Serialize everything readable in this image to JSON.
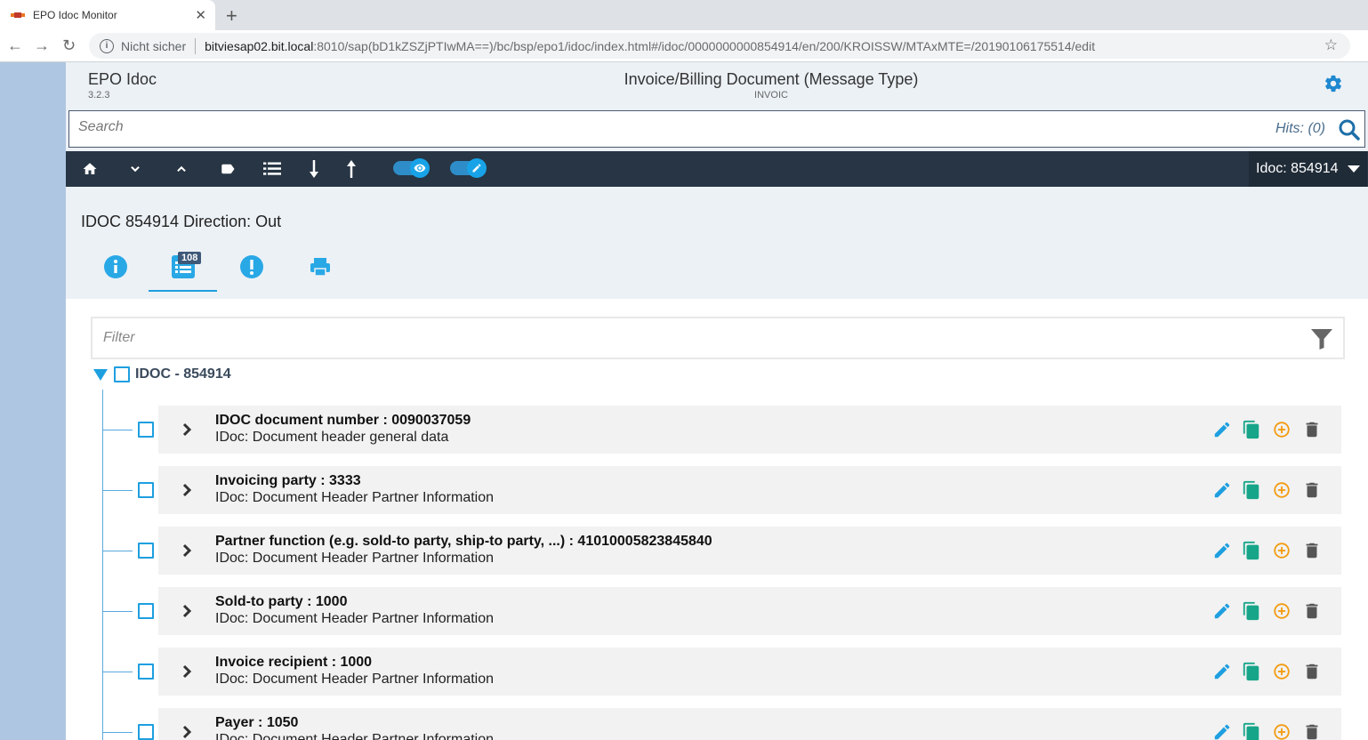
{
  "browser": {
    "tab_title": "EPO Idoc Monitor",
    "insecure_label": "Nicht sicher",
    "url_host": "bitviesap02.bit.local",
    "url_path": ":8010/sap(bD1kZSZjPTIwMA==)/bc/bsp/epo1/idoc/index.html#/idoc/0000000000854914/en/200/KROISSW/MTAxMTE=/20190106175514/edit"
  },
  "app": {
    "brand": "EPO Idoc",
    "version": "3.2.3",
    "doc_title": "Invoice/Billing Document (Message Type)",
    "doc_subtitle": "INVOIC"
  },
  "search": {
    "placeholder": "Search",
    "hits": "Hits: (0)"
  },
  "toolbar": {
    "idoc_selector": "Idoc: 854914"
  },
  "idoc": {
    "heading": "IDOC 854914 Direction: Out",
    "segments_badge": "108"
  },
  "filter": {
    "placeholder": "Filter"
  },
  "tree": {
    "root_label": "IDOC - 854914",
    "nodes": [
      {
        "title": "IDOC document number : 0090037059",
        "desc": "IDoc: Document header general data"
      },
      {
        "title": "Invoicing party : 3333",
        "desc": "IDoc: Document Header Partner Information"
      },
      {
        "title": "Partner function (e.g. sold-to party, ship-to party, ...) : 41010005823845840",
        "desc": "IDoc: Document Header Partner Information"
      },
      {
        "title": "Sold-to party : 1000",
        "desc": "IDoc: Document Header Partner Information"
      },
      {
        "title": "Invoice recipient : 1000",
        "desc": "IDoc: Document Header Partner Information"
      },
      {
        "title": "Payer : 1050",
        "desc": "IDoc: Document Header Partner Information"
      }
    ]
  },
  "colors": {
    "accent": "#1e9fe0",
    "toolbar_bg": "#273544",
    "copy_icon": "#17a589",
    "add_icon": "#f39c12",
    "delete_icon": "#555555"
  }
}
